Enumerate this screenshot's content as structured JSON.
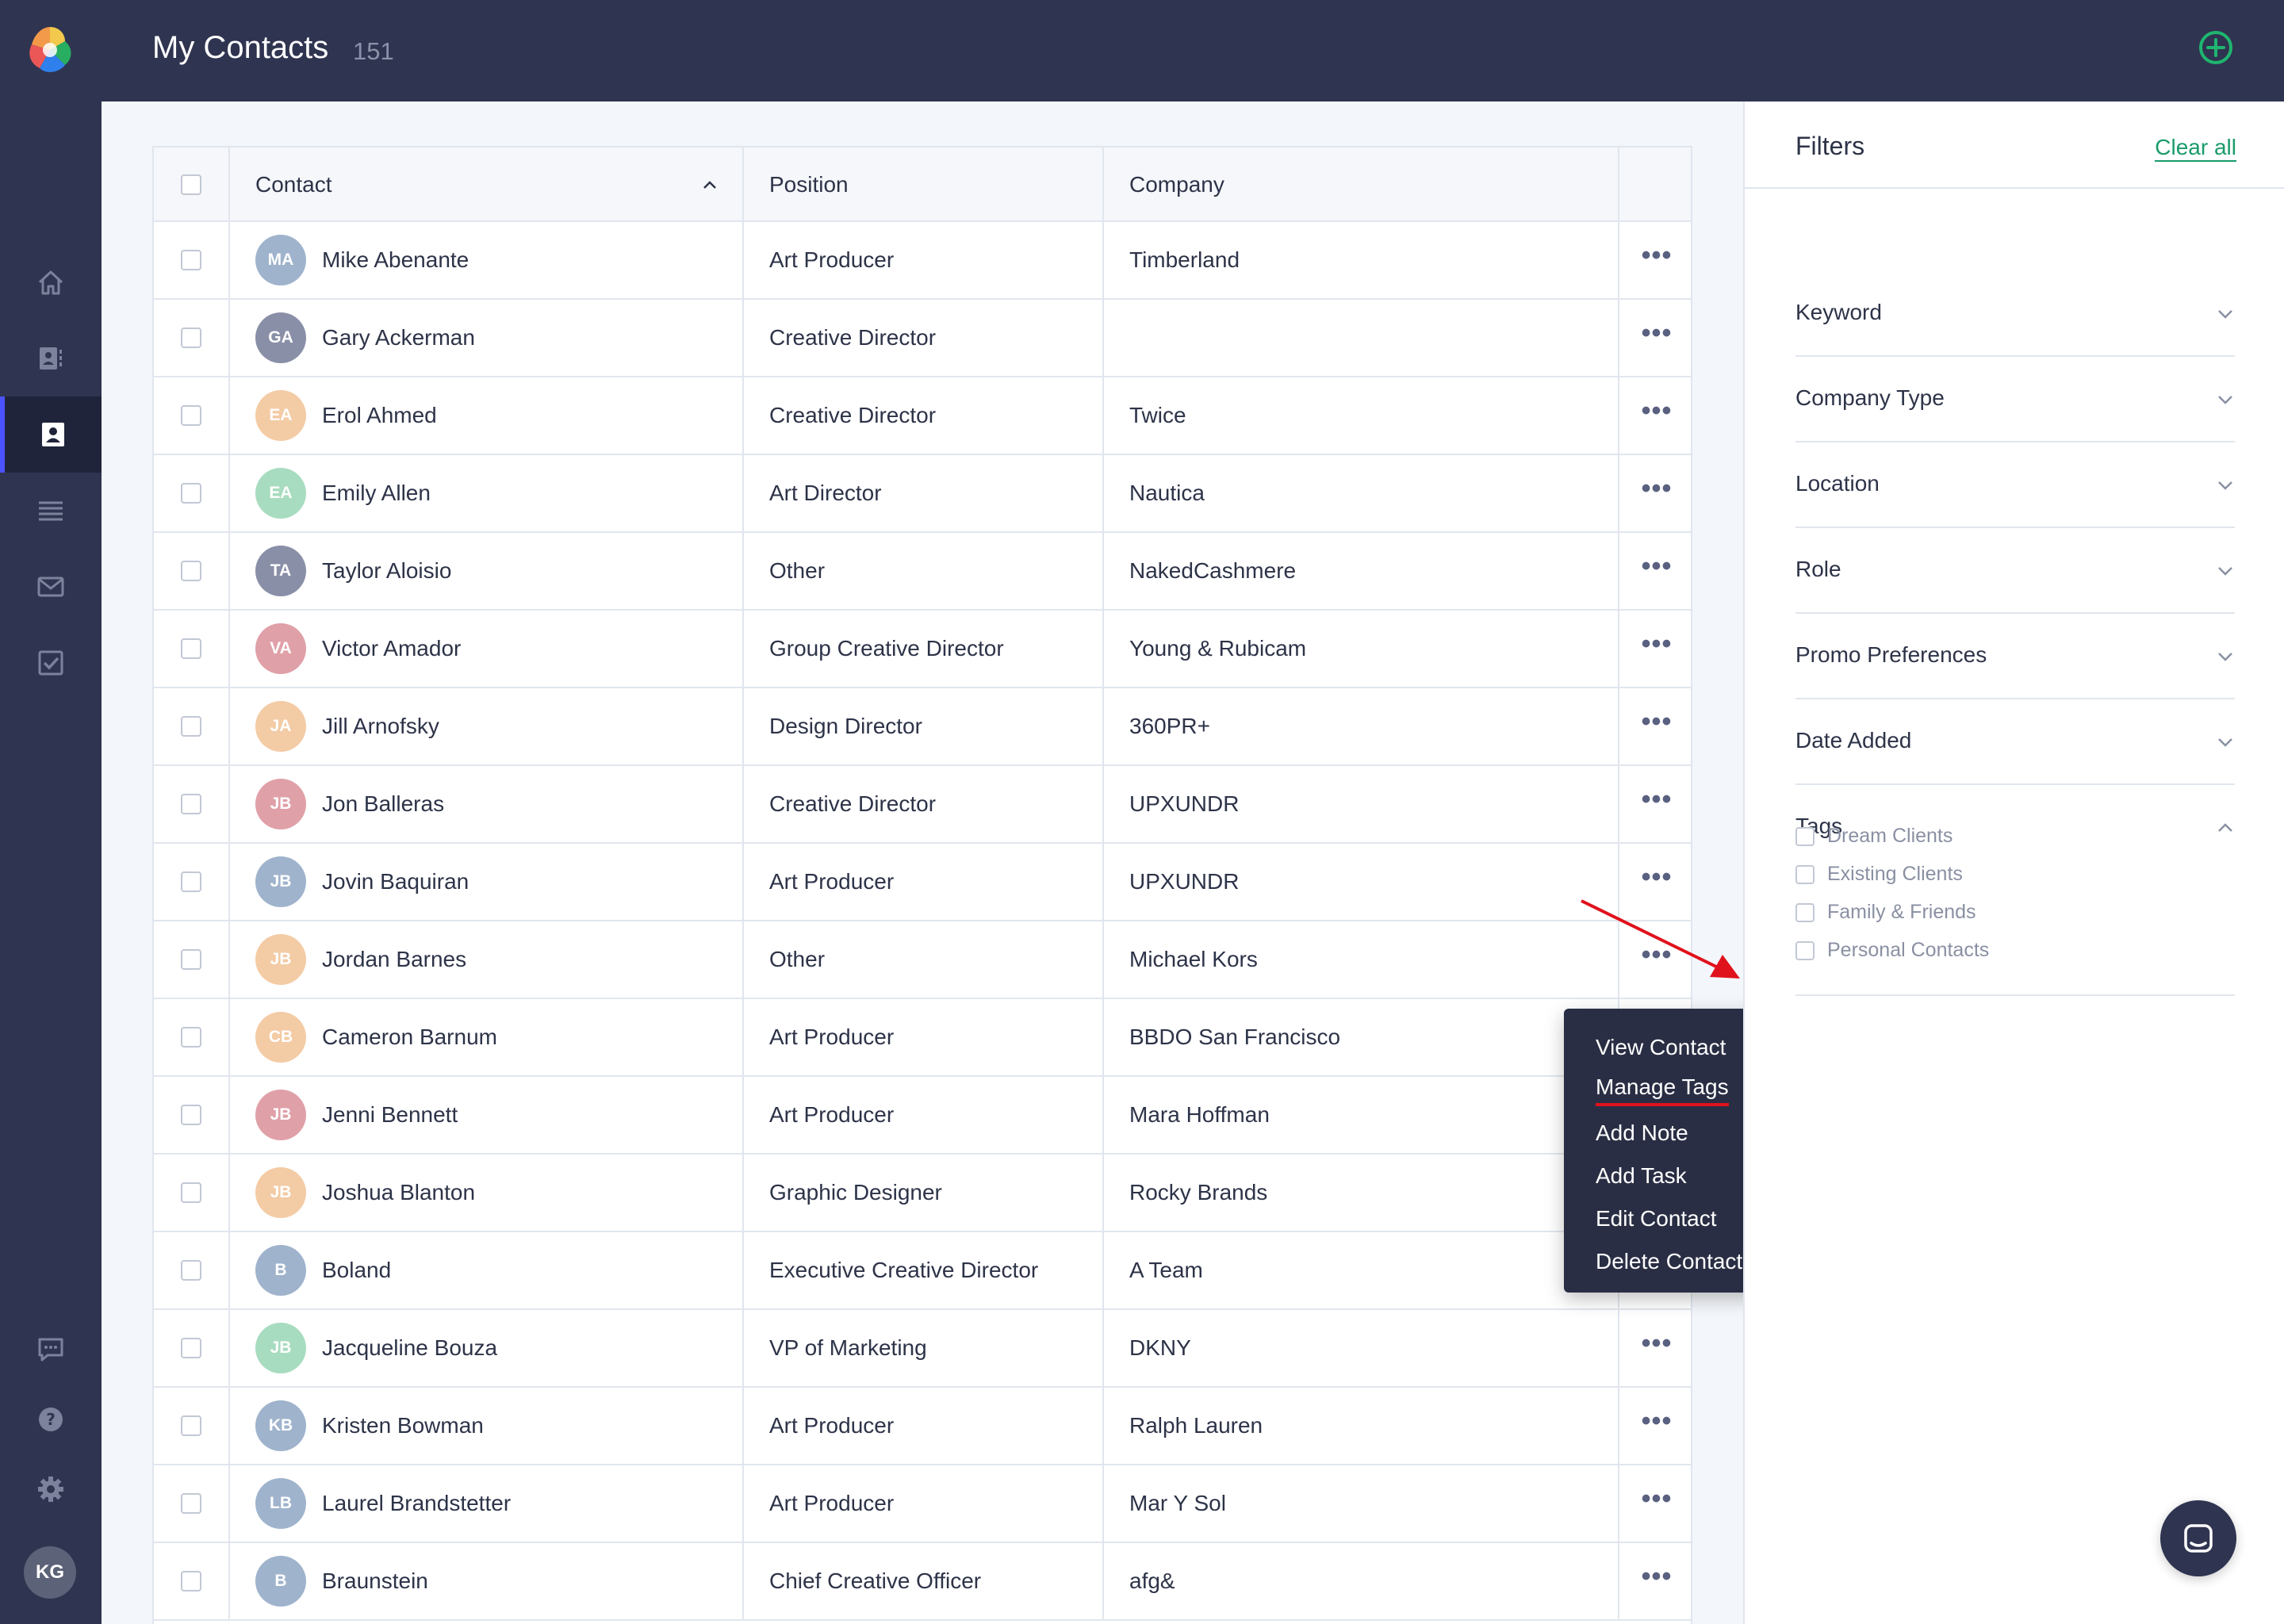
{
  "header": {
    "title": "My Contacts",
    "count": "151"
  },
  "user": {
    "initials": "KG"
  },
  "nav": {
    "items": [
      "home-icon",
      "address-book-icon",
      "contacts-icon",
      "list-icon",
      "mail-icon",
      "tasks-icon"
    ],
    "active": "contacts-icon",
    "bottom": [
      "feedback-icon",
      "help-icon",
      "settings-icon"
    ]
  },
  "table": {
    "columns": {
      "contact": "Contact",
      "position": "Position",
      "company": "Company"
    },
    "rows": [
      {
        "initials": "MA",
        "name": "Mike Abenante",
        "position": "Art Producer",
        "company": "Timberland",
        "color": "#9fb3cc"
      },
      {
        "initials": "GA",
        "name": "Gary Ackerman",
        "position": "Creative Director",
        "company": "",
        "color": "#8a8fa8"
      },
      {
        "initials": "EA",
        "name": "Erol Ahmed",
        "position": "Creative Director",
        "company": "Twice",
        "color": "#f3cba5"
      },
      {
        "initials": "EA",
        "name": "Emily Allen",
        "position": "Art Director",
        "company": "Nautica",
        "color": "#a8dcc0"
      },
      {
        "initials": "TA",
        "name": "Taylor Aloisio",
        "position": "Other",
        "company": "NakedCashmere",
        "color": "#8a8fa8"
      },
      {
        "initials": "VA",
        "name": "Victor Amador",
        "position": "Group Creative Director",
        "company": "Young & Rubicam",
        "color": "#e0a0a8"
      },
      {
        "initials": "JA",
        "name": "Jill Arnofsky",
        "position": "Design Director",
        "company": "360PR+",
        "color": "#f3cba5"
      },
      {
        "initials": "JB",
        "name": "Jon Balleras",
        "position": "Creative Director",
        "company": "UPXUNDR",
        "color": "#e0a0a8"
      },
      {
        "initials": "JB",
        "name": "Jovin Baquiran",
        "position": "Art Producer",
        "company": "UPXUNDR",
        "color": "#9fb3cc"
      },
      {
        "initials": "JB",
        "name": "Jordan Barnes",
        "position": "Other",
        "company": "Michael Kors",
        "color": "#f3cba5"
      },
      {
        "initials": "CB",
        "name": "Cameron Barnum",
        "position": "Art Producer",
        "company": "BBDO San Francisco",
        "color": "#f3cba5"
      },
      {
        "initials": "JB",
        "name": "Jenni Bennett",
        "position": "Art Producer",
        "company": "Mara Hoffman",
        "color": "#e0a0a8"
      },
      {
        "initials": "JB",
        "name": "Joshua Blanton",
        "position": "Graphic Designer",
        "company": "Rocky Brands",
        "color": "#f3cba5"
      },
      {
        "initials": "B",
        "name": "Boland",
        "position": "Executive Creative Director",
        "company": "A Team",
        "color": "#9fb3cc"
      },
      {
        "initials": "JB",
        "name": "Jacqueline Bouza",
        "position": "VP of Marketing",
        "company": "DKNY",
        "color": "#a8dcc0"
      },
      {
        "initials": "KB",
        "name": "Kristen Bowman",
        "position": "Art Producer",
        "company": "Ralph Lauren",
        "color": "#9fb3cc"
      },
      {
        "initials": "LB",
        "name": "Laurel Brandstetter",
        "position": "Art Producer",
        "company": "Mar Y Sol",
        "color": "#9fb3cc"
      },
      {
        "initials": "B",
        "name": "Braunstein",
        "position": "Chief Creative Officer",
        "company": "afg&",
        "color": "#9fb3cc"
      }
    ]
  },
  "context_menu": {
    "items": [
      "View Contact",
      "Manage Tags",
      "Add Note",
      "Add Task",
      "Edit Contact",
      "Delete Contact"
    ],
    "highlighted": "Manage Tags"
  },
  "filters": {
    "title": "Filters",
    "clear_all": "Clear all",
    "groups": [
      "Keyword",
      "Company Type",
      "Location",
      "Role",
      "Promo Preferences",
      "Date Added",
      "Tags"
    ],
    "tags": [
      "Dream Clients",
      "Existing Clients",
      "Family & Friends",
      "Personal Contacts"
    ]
  },
  "colors": {
    "header_bg": "#2f3450",
    "accent_green": "#1a9b6a",
    "annotation_red": "#e0121c"
  }
}
